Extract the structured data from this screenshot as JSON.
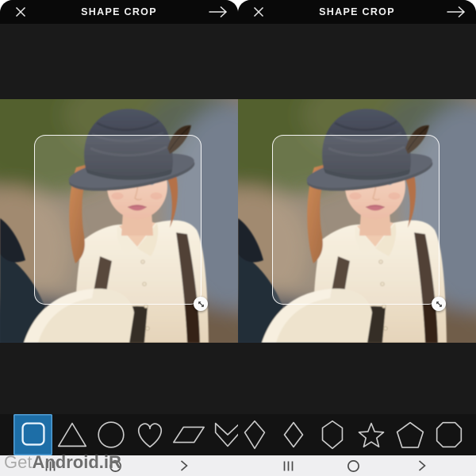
{
  "panel_left": {
    "header": {
      "title": "SHAPE CROP",
      "left_icon": "close-x",
      "right_icon": "arrow-right-next"
    },
    "shapes": [
      {
        "name": "square",
        "selected": true
      },
      {
        "name": "triangle"
      },
      {
        "name": "circle"
      },
      {
        "name": "heart"
      },
      {
        "name": "parallelogram"
      },
      {
        "name": "chevron"
      }
    ],
    "crop": {
      "shape": "rounded-square",
      "handle_icon": "diagonal-resize-arrow"
    },
    "navbar": {
      "icons": [
        "recent-apps",
        "home",
        "back"
      ]
    }
  },
  "panel_right": {
    "header": {
      "title": "SHAPE CROP",
      "left_icon": "close-x",
      "right_icon": "arrow-right-next"
    },
    "shapes": [
      {
        "name": "kite"
      },
      {
        "name": "diamond"
      },
      {
        "name": "hexagon"
      },
      {
        "name": "star"
      },
      {
        "name": "pentagon"
      },
      {
        "name": "octagon"
      }
    ],
    "crop": {
      "shape": "rounded-square",
      "handle_icon": "diagonal-resize-arrow"
    },
    "navbar": {
      "icons": [
        "recent-apps",
        "home",
        "back"
      ]
    }
  },
  "watermark": {
    "light": "Get",
    "bold": "Android.iR"
  },
  "colors": {
    "topbar_bg": "#090909",
    "panel_bg": "#1a1a1a",
    "strip_bg": "#131313",
    "navbar_bg": "#efeff1",
    "shape_outline": "#cccccc",
    "selected_tile": "#1d6ea7",
    "selected_tile_border": "#539fd6",
    "crop_border": "#ffffff"
  }
}
